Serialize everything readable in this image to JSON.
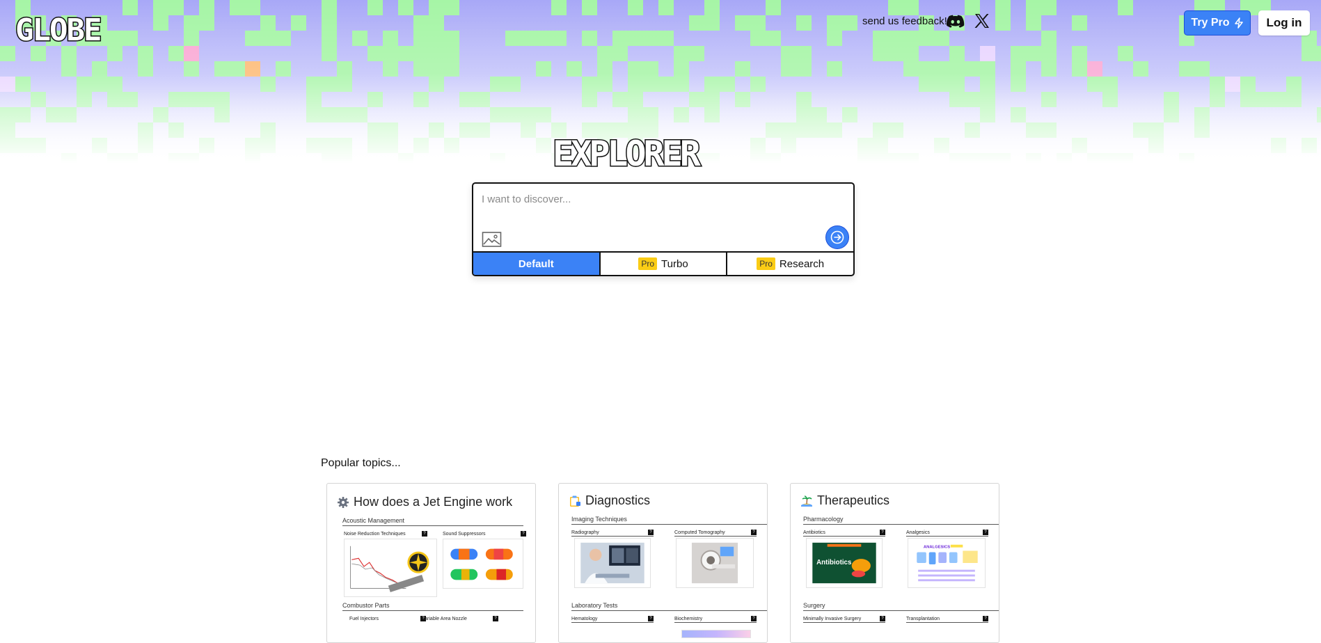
{
  "header": {
    "logo_text": "GLOBE",
    "feedback_text": "send us feedback!",
    "try_pro_label": "Try Pro",
    "login_label": "Log in"
  },
  "hero": {
    "title": "EXPLORER"
  },
  "search": {
    "placeholder": "I want to discover...",
    "modes": [
      {
        "label": "Default",
        "pro": false,
        "active": true
      },
      {
        "label": "Turbo",
        "pro": true,
        "active": false
      },
      {
        "label": "Research",
        "pro": true,
        "active": false
      }
    ],
    "pro_tag": "Pro"
  },
  "popular": {
    "heading": "Popular topics...",
    "cards": [
      {
        "title": "How does a Jet Engine work",
        "icon": "gear-icon",
        "sections": [
          {
            "label": "Acoustic Management",
            "subs": [
              "Noise Reduction Techniques",
              "Sound Suppressors"
            ]
          },
          {
            "label": "Combustor Parts",
            "subs": [
              "Fuel Injectors",
              "Variable Area Nozzle"
            ]
          }
        ]
      },
      {
        "title": "Diagnostics",
        "icon": "clipboard-icon",
        "sections": [
          {
            "label": "Imaging Techniques",
            "subs": [
              "Radiography",
              "Computed Tomography"
            ]
          },
          {
            "label": "Laboratory Tests",
            "subs": [
              "Hematology",
              "Biochemistry"
            ]
          }
        ]
      },
      {
        "title": "Therapeutics",
        "icon": "island-icon",
        "sections": [
          {
            "label": "Pharmacology",
            "subs": [
              "Antibiotics",
              "Analgesics"
            ]
          },
          {
            "label": "Surgery",
            "subs": [
              "Minimally Invasive Surgery",
              "Transplantation"
            ]
          }
        ]
      }
    ],
    "thumb_texts": {
      "antibiotics": "Antibiotics",
      "analgesics": "ANALGESICS"
    }
  },
  "colors": {
    "accent": "#3b82f6",
    "pro_yellow": "#facc15",
    "bg_purple": "#a6a6f5",
    "bg_green": "#a6f5a6"
  }
}
